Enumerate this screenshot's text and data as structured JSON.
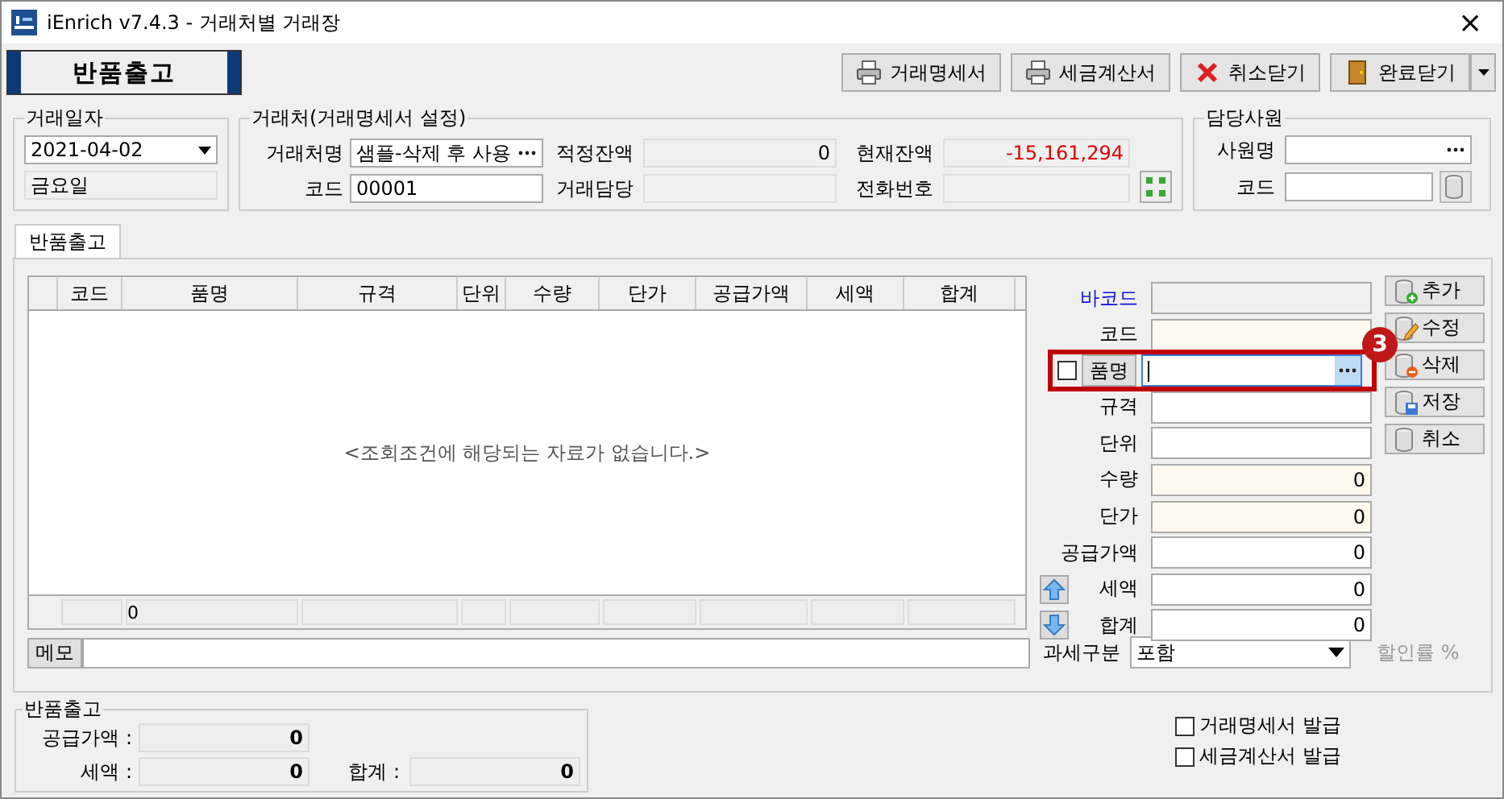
{
  "window": {
    "title": "iEnrich v7.4.3 - 거래처별 거래장",
    "close": "×"
  },
  "header": {
    "title": "반품출고"
  },
  "toolbar": [
    {
      "label": "거래명세서"
    },
    {
      "label": "세금계산서"
    },
    {
      "label": "취소닫기"
    },
    {
      "label": "완료닫기"
    }
  ],
  "date_group": {
    "legend": "거래일자",
    "date": "2021-04-02",
    "weekday": "금요일"
  },
  "client_group": {
    "legend": "거래처(거래명세서 설정)",
    "fields": [
      {
        "label": "거래처명",
        "value": "샘플-삭제 후 사용",
        "kind": "lookup"
      },
      {
        "label": "적정잔액",
        "value": "0",
        "kind": "readonly",
        "negative": false
      },
      {
        "label": "현재잔액",
        "value": "-15,161,294",
        "kind": "readonly",
        "negative": true
      },
      {
        "label": "코드",
        "value": "00001",
        "kind": "text"
      },
      {
        "label": "거래담당",
        "kind": "readonly"
      },
      {
        "label": "전화번호",
        "kind": "readonly"
      }
    ]
  },
  "staff_group": {
    "legend": "담당사원",
    "fields": [
      {
        "label": "사원명",
        "kind": "lookup"
      },
      {
        "label": "코드",
        "kind": "db"
      }
    ]
  },
  "tabs": [
    {
      "label": "반품출고",
      "selected": true
    }
  ],
  "grid": {
    "columns": [
      "코드",
      "품명",
      "규격",
      "단위",
      "수량",
      "단가",
      "공급가액",
      "세액",
      "합계"
    ],
    "empty_message": "<조회조건에 해당되는 자료가 없습니다.>",
    "footer_count": "0"
  },
  "item_form": [
    {
      "label": "바코드",
      "kind": "barcode"
    },
    {
      "label": "코드",
      "kind": "required"
    },
    {
      "label": "품명",
      "kind": "lookup",
      "checked": false
    },
    {
      "label": "규격",
      "kind": "text"
    },
    {
      "label": "단위",
      "kind": "text"
    },
    {
      "label": "수량",
      "kind": "required",
      "value": "0"
    },
    {
      "label": "단가",
      "kind": "required",
      "value": "0"
    },
    {
      "label": "공급가액",
      "kind": "text",
      "value": "0"
    },
    {
      "label": "세액",
      "kind": "text",
      "value": "0"
    },
    {
      "label": "합계",
      "kind": "text",
      "value": "0"
    }
  ],
  "actions": [
    {
      "label": "추가"
    },
    {
      "label": "수정"
    },
    {
      "label": "삭제"
    },
    {
      "label": "저장"
    },
    {
      "label": "취소"
    }
  ],
  "memo": {
    "label": "메모"
  },
  "tax": {
    "label": "과세구분",
    "value": "포함"
  },
  "discount_label": "할인률 %",
  "summary": {
    "legend": "반품출고",
    "supply_label": "공급가액 :",
    "supply": "0",
    "tax_label": "세액 :",
    "tax": "0",
    "total_label": "합계 :",
    "total": "0"
  },
  "print_options": [
    {
      "label": "거래명세서 발급",
      "checked": false
    },
    {
      "label": "세금계산서 발급",
      "checked": false
    }
  ],
  "annotation": {
    "label": "3"
  }
}
